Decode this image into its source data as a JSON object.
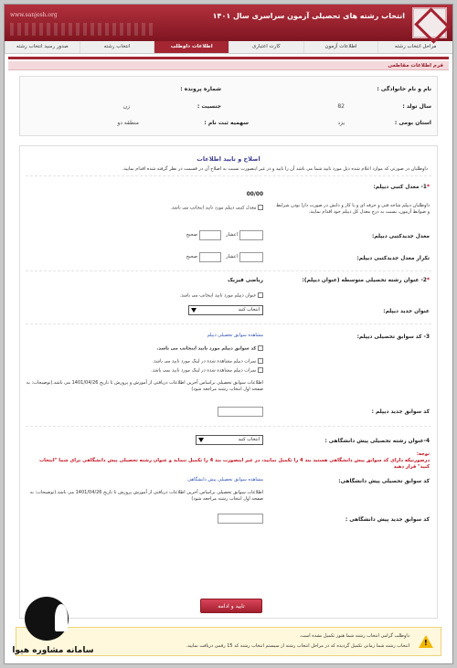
{
  "header": {
    "title": "انتخاب رشته های تحصیلی آزمون سراسری سال ۱۴۰۱",
    "site": "www.sanjesh.org"
  },
  "tabs": [
    {
      "label": "مراحل انتخاب رشته",
      "active": false
    },
    {
      "label": "اطلاعات آزمون",
      "active": false
    },
    {
      "label": "کارت اعتباری",
      "active": false
    },
    {
      "label": "اطلاعات داوطلب",
      "active": true
    },
    {
      "label": "انتخاب رشته",
      "active": false
    },
    {
      "label": "صدور رسید انتخاب رشته",
      "active": false
    }
  ],
  "section_title": "فرم اطلاعات مقاطعی",
  "info": {
    "name_label": "نام و نام خانوادگی :",
    "dossier_label": "شماره پرونده :",
    "birth_year_label": "سال تولد :",
    "birth_year_value": "82",
    "gender_label": "جنسیت :",
    "gender_value": "زن",
    "province_label": "استان بومی :",
    "province_value": "یزد",
    "quota_label": "سهمیه ثبت نام :",
    "quota_value": "منطقه دو"
  },
  "form": {
    "title": "اصلاح و تایید اطلاعات",
    "description": "داوطلبان در صورتی که موارد اعلام شده ذیل مورد تایید شما می باشد آن را تایید و در غیر اینصورت نسبت به اصلاح آن در قسمت در نظر گرفته شده اقدام نمایید.",
    "q1_label": "1- معدل کتبی دیپلم:",
    "q1_value": "00/00",
    "q1_check_text": "معدل کتبی دیپلم مورد تایید اینجانب می باشد.",
    "q1_note": "داوطلبان دیپلم شاخه فنی و حرفه ای و یا کار و دانش در صورت دارا بودن شرایط و ضوابط آزمون، نسبت به درج معدل کل دیپلم خود اقدام نمایند.",
    "new_avg_label": "معدل جدیدکتبی دیپلم:",
    "repeat_avg_label": "تکرار معدل جدیدکتبی دیپلم:",
    "decimal_label": "اعشار",
    "integer_label": "صحیح",
    "q2_label": "2- عنوان رشته تحصیلی متوسطه (عنوان دیپلم):",
    "q2_value": "ریاضی فیزیک",
    "q2_check_text": "عنوان دیپلم مورد تایید اینجانب می باشد.",
    "new_title_label": "عنوان جدید دیپلم:",
    "select_placeholder": "انتخاب کنید",
    "q3_label": "3- کد سوابق تحصیلی دیپلم:",
    "q3_link": "مشاهده سوابق تحصیلی دیپلم",
    "q3_check_main": "کد سوابق دیپلم مورد تایید اینجانب می باشد.",
    "q3_opt1": "نمرات دیپلم مشاهده شده در لینک مورد تایید می باشد.",
    "q3_opt2": "نمرات دیپلم مشاهده شده در لینک مورد تایید نمی باشد.",
    "q3_note": "اطلاعات سوابق تحصیلی براساس آخرین اطلاعات دریافتی از آموزش و پرورش تا تاریخ 1401/04/26 می باشد.(توضیحات: به صفحه اول انتخاب رشته مراجعه شود)",
    "new_code_label": "کد سوابق جدید دیپلم :",
    "q4_label": "4-عنوان رشته تحصیلی پیش دانشگاهی :",
    "q4_warning_1": "توجه:",
    "q4_warning_2": "درصورتیکه دارای کد سوابق پیش دانشگاهی هستید بند 4 را تکمیل نمایید، در غیر اینصورت بند 4 را تکمیل ننماید و عنوان رشته تحصیلی پیش دانشگاهی برای شما \"انتخاب کنید\" قرار دهید",
    "preuni_code_label": "کد سوابق تحصیلی پیش دانشگاهی:",
    "preuni_link": "مشاهده سوابق تحصیلی پیش دانشگاهی",
    "preuni_note": "اطلاعات سوابق تحصیلی براساس آخرین اطلاعات دریافتی از آموزش پرورش تا تاریخ 1401/04/26 می باشد.(توضیحات: به صفحه اول انتخاب رشته مراجعه شود)",
    "preuni_new_code_label": "کد سوابق جدید پیش دانشگاهی :",
    "submit_label": "تایید و ادامه"
  },
  "notice": {
    "line1": "داوطلب گرامی انتخاب رشته شما هنوز تکمیل نشده است.",
    "line2": "انتخاب رشته شما زمانی تکمیل گردیده که در مراحل انتخاب رشته از سیستم انتخاب رشته کد 15 رقمی دریافت نمایید."
  },
  "watermark": {
    "text": "سامانه مشاوره هیوا"
  }
}
